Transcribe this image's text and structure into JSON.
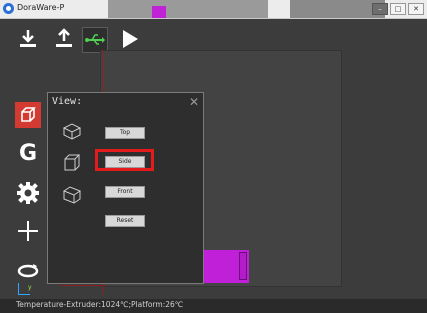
{
  "window": {
    "title": "DoraWare-P",
    "controls": [
      "minimize",
      "maximize",
      "close"
    ]
  },
  "toolbar": {
    "icons": [
      "import-icon",
      "export-icon",
      "usb-icon",
      "play-icon"
    ]
  },
  "sidebar": {
    "icons": [
      "view-cube-icon",
      "g-letter-icon",
      "settings-gear-icon",
      "add-plus-icon",
      "rotate-icon"
    ],
    "g_label": "G"
  },
  "view_dialog": {
    "title": "View:",
    "close_glyph": "✕",
    "buttons": [
      {
        "label": "Top"
      },
      {
        "label": "Side"
      },
      {
        "label": "Front"
      },
      {
        "label": "Reset"
      }
    ],
    "highlighted_button": "Side"
  },
  "status": {
    "text": "Temperature-Extruder:1024℃;Platform:26℃"
  },
  "axis": {
    "label": "y"
  },
  "colors": {
    "accent_red": "#e31b1b",
    "object_magenta": "#c020d8",
    "background": "#3c3c3c"
  }
}
